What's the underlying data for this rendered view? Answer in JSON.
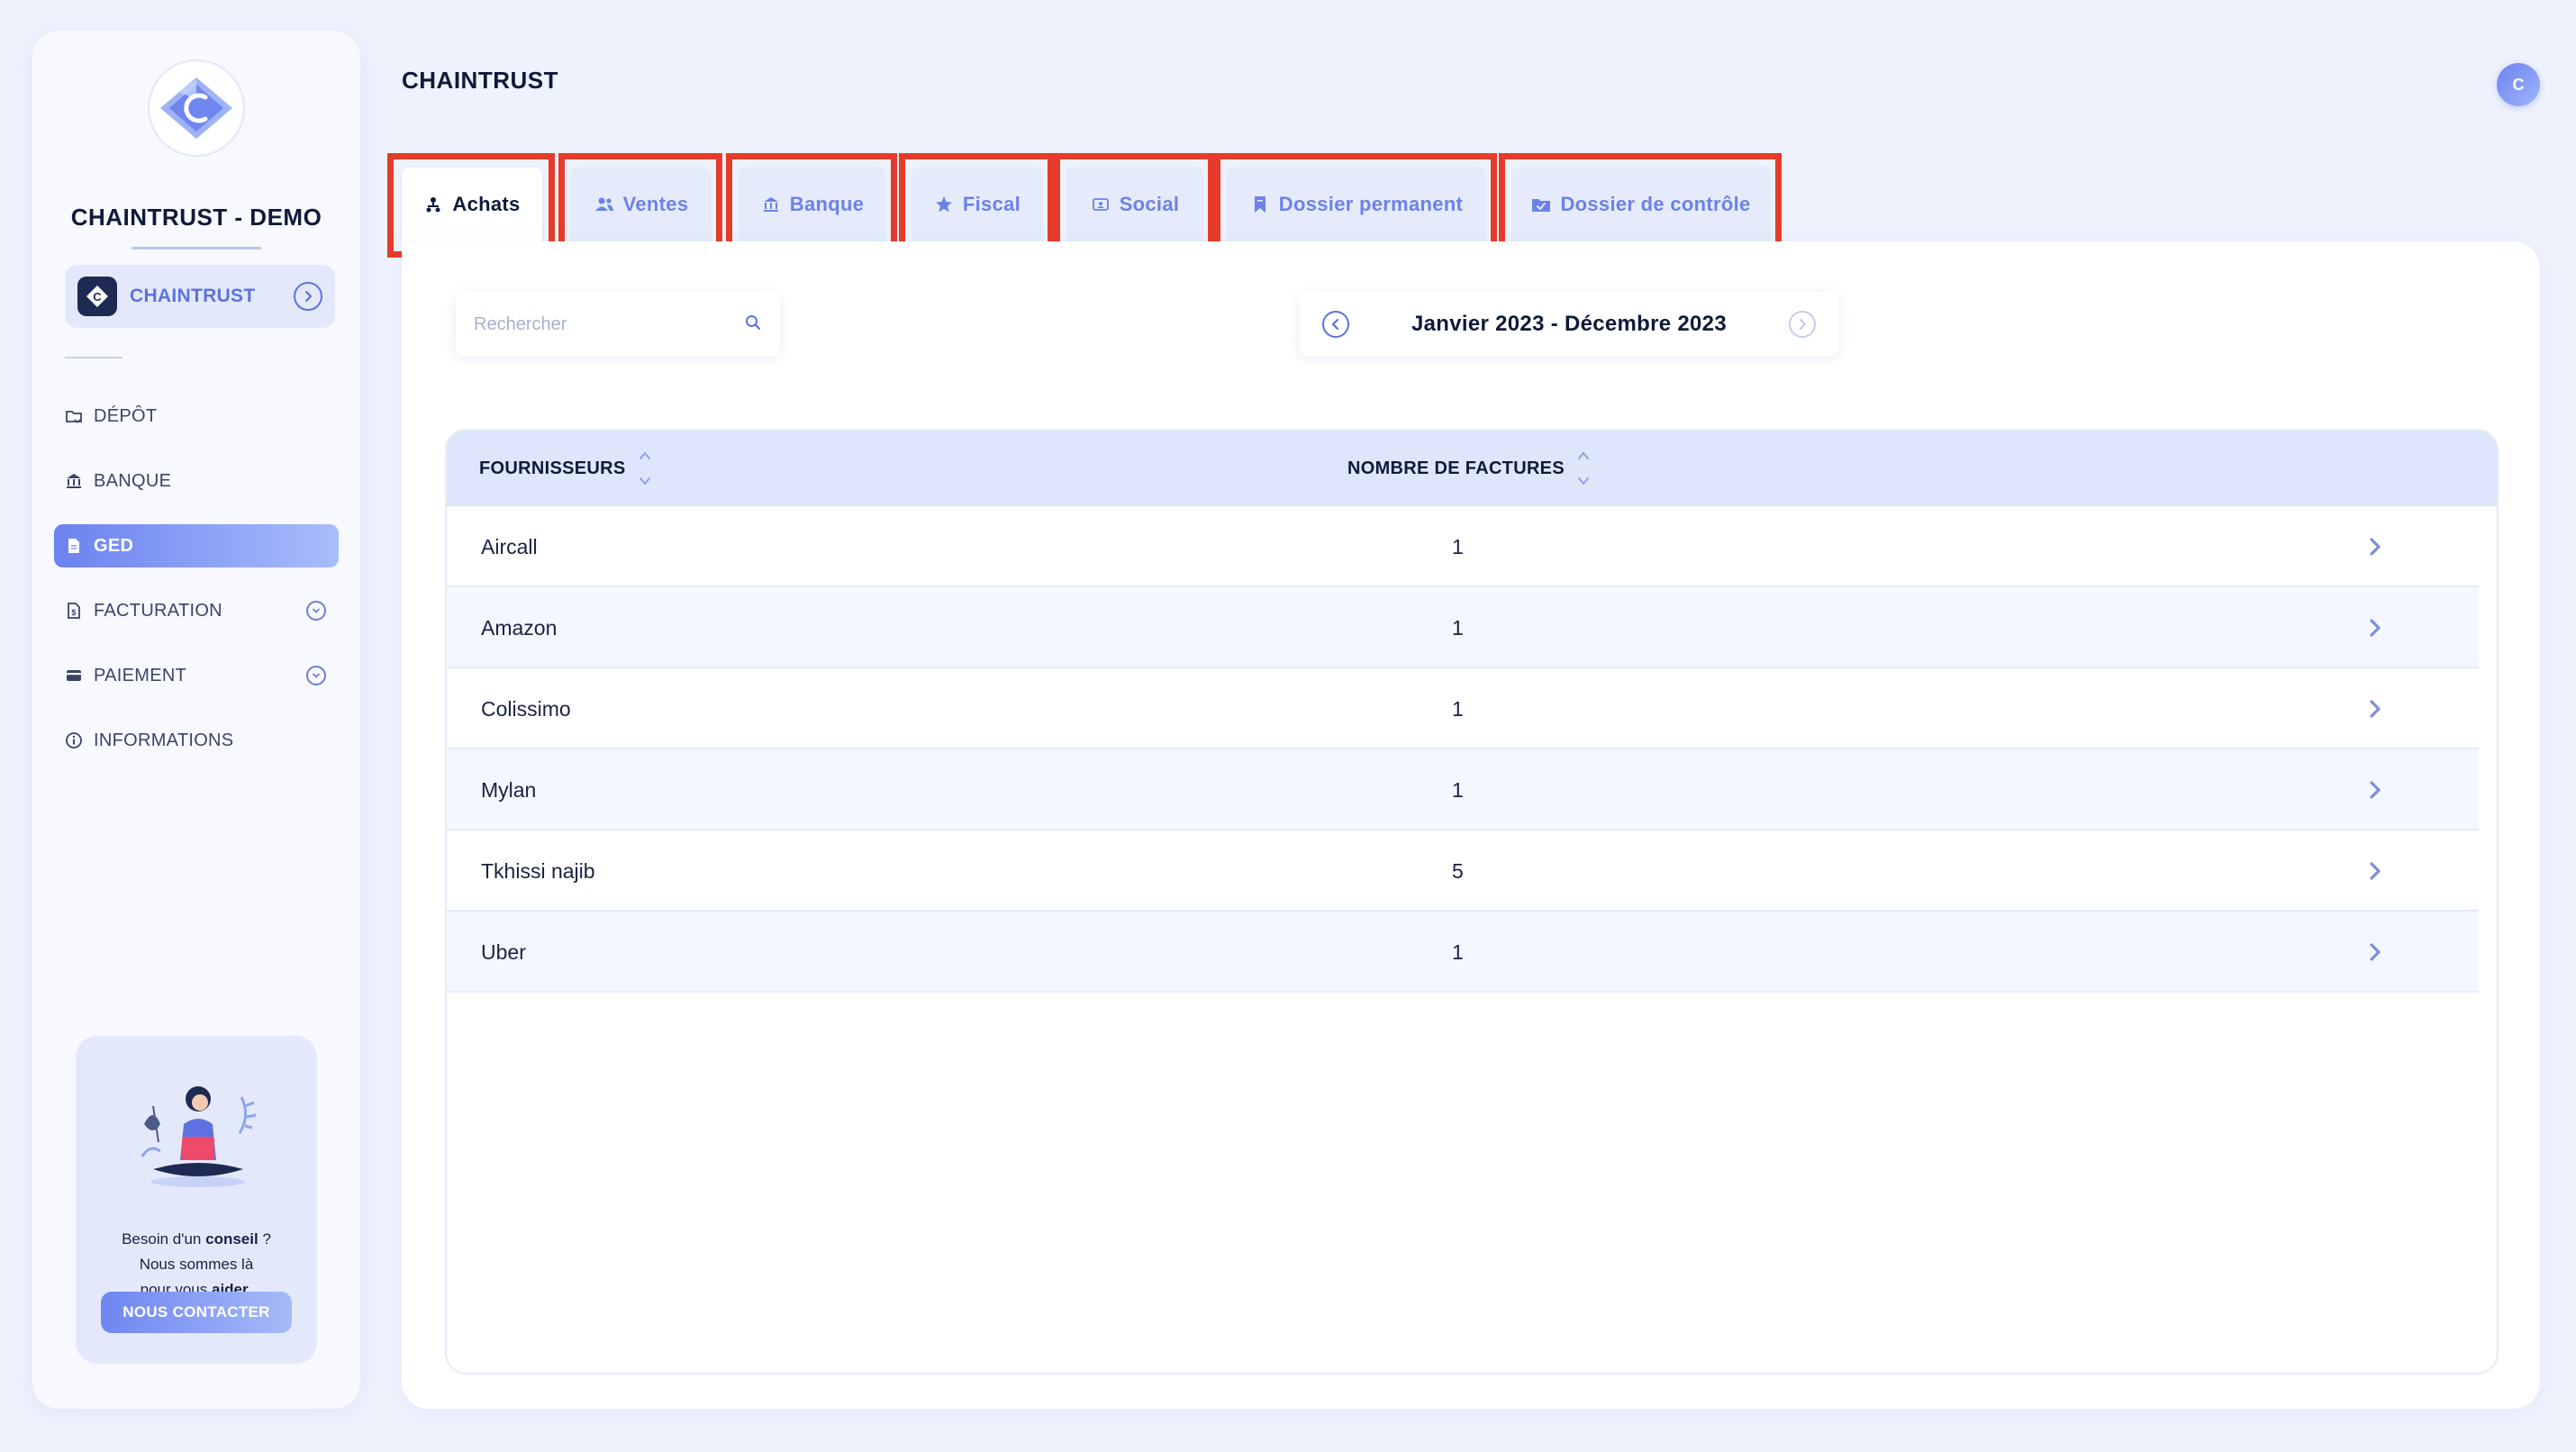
{
  "sidebar": {
    "company_name": "CHAINTRUST - DEMO",
    "org_card": {
      "label": "CHAINTRUST",
      "badge_letter": "C"
    },
    "nav": [
      {
        "label": "DÉPÔT",
        "icon": "folder-upload-icon",
        "active": false,
        "expandable": false
      },
      {
        "label": "BANQUE",
        "icon": "bank-icon",
        "active": false,
        "expandable": false
      },
      {
        "label": "GED",
        "icon": "document-icon",
        "active": true,
        "expandable": false
      },
      {
        "label": "FACTURATION",
        "icon": "invoice-icon",
        "active": false,
        "expandable": true
      },
      {
        "label": "PAIEMENT",
        "icon": "card-icon",
        "active": false,
        "expandable": true
      },
      {
        "label": "INFORMATIONS",
        "icon": "info-icon",
        "active": false,
        "expandable": false
      }
    ],
    "help": {
      "line1_prefix": "Besoin d'un ",
      "line1_bold": "conseil",
      "line1_suffix": " ?",
      "line2": "Nous sommes là",
      "line3_prefix": "pour vous ",
      "line3_bold": "aider",
      "line3_suffix": ".",
      "button": "NOUS CONTACTER"
    }
  },
  "header": {
    "title": "CHAINTRUST",
    "avatar_letter": "C"
  },
  "tabs": [
    {
      "label": "Achats",
      "icon": "people-icon",
      "active": true
    },
    {
      "label": "Ventes",
      "icon": "users-icon",
      "active": false
    },
    {
      "label": "Banque",
      "icon": "bank-icon",
      "active": false
    },
    {
      "label": "Fiscal",
      "icon": "star-icon",
      "active": false
    },
    {
      "label": "Social",
      "icon": "id-card-icon",
      "active": false
    },
    {
      "label": "Dossier permanent",
      "icon": "bookmark-icon",
      "active": false
    },
    {
      "label": "Dossier de contrôle",
      "icon": "folder-check-icon",
      "active": false
    }
  ],
  "search": {
    "placeholder": "Rechercher",
    "value": ""
  },
  "period": {
    "label": "Janvier 2023 - Décembre 2023"
  },
  "table": {
    "columns": [
      "FOURNISSEURS",
      "NOMBRE DE FACTURES"
    ],
    "rows": [
      {
        "supplier": "Aircall",
        "invoices": "1"
      },
      {
        "supplier": "Amazon",
        "invoices": "1"
      },
      {
        "supplier": "Colissimo",
        "invoices": "1"
      },
      {
        "supplier": "Mylan",
        "invoices": "1"
      },
      {
        "supplier": "Tkhissi najib",
        "invoices": "5"
      },
      {
        "supplier": "Uber",
        "invoices": "1"
      }
    ]
  },
  "colors": {
    "accent": "#5d72e0",
    "highlight_frame": "#e63b2a",
    "background": "#eef2fd"
  }
}
